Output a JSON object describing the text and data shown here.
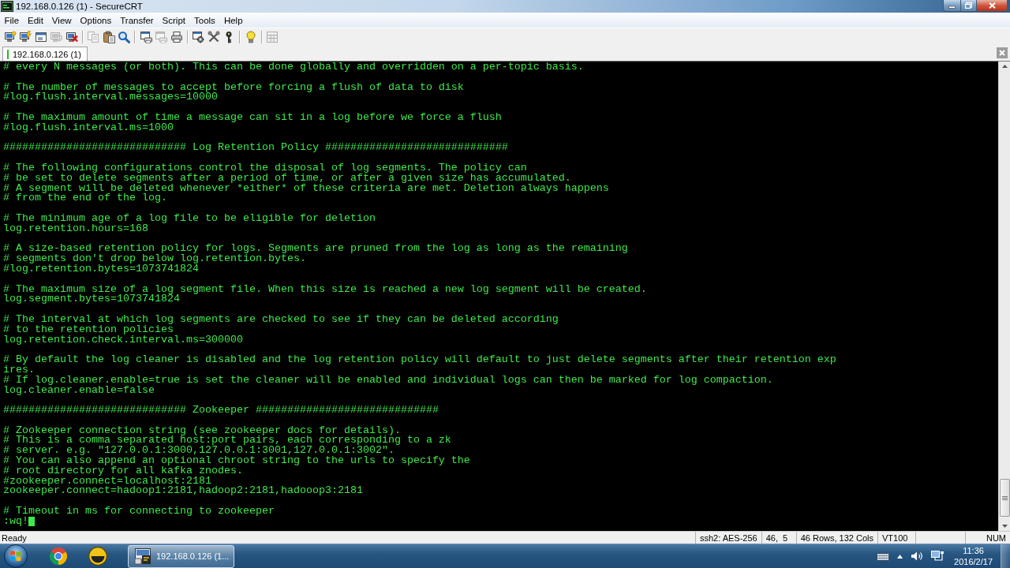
{
  "window": {
    "title": "192.168.0.126 (1) - SecureCRT"
  },
  "menu": [
    "File",
    "Edit",
    "View",
    "Options",
    "Transfer",
    "Script",
    "Tools",
    "Help"
  ],
  "toolbar": [
    {
      "kind": "connect",
      "disabled": false
    },
    {
      "kind": "quickconnect",
      "disabled": false
    },
    {
      "kind": "tab",
      "disabled": false
    },
    {
      "kind": "reconnect",
      "disabled": true
    },
    {
      "kind": "disconnect",
      "disabled": false
    },
    {
      "kind": "separator"
    },
    {
      "kind": "copy",
      "disabled": true
    },
    {
      "kind": "paste",
      "disabled": false
    },
    {
      "kind": "find",
      "disabled": false
    },
    {
      "kind": "separator"
    },
    {
      "kind": "printscreen",
      "disabled": false
    },
    {
      "kind": "printselection",
      "disabled": true
    },
    {
      "kind": "print",
      "disabled": false
    },
    {
      "kind": "separator"
    },
    {
      "kind": "sessionoptions",
      "disabled": false
    },
    {
      "kind": "globaloptions",
      "disabled": false
    },
    {
      "kind": "keymap",
      "disabled": false
    },
    {
      "kind": "separator"
    },
    {
      "kind": "help",
      "disabled": false
    },
    {
      "kind": "separator"
    },
    {
      "kind": "sftp",
      "disabled": true
    }
  ],
  "tabs": [
    {
      "label": "192.168.0.126 (1)",
      "selected": true,
      "connected": true
    }
  ],
  "terminal": {
    "blocks": [
      {
        "lines": [
          "# every N messages (or both). This can be done globally and overridden on a per-topic basis."
        ]
      },
      {
        "lines": [
          "# The number of messages to accept before forcing a flush of data to disk",
          "#log.flush.interval.messages=10000"
        ]
      },
      {
        "lines": [
          "# The maximum amount of time a message can sit in a log before we force a flush",
          "#log.flush.interval.ms=1000"
        ]
      },
      {
        "lines": [
          "############################# Log Retention Policy #############################"
        ]
      },
      {
        "lines": [
          "# The following configurations control the disposal of log segments. The policy can",
          "# be set to delete segments after a period of time, or after a given size has accumulated.",
          "# A segment will be deleted whenever *either* of these criteria are met. Deletion always happens",
          "# from the end of the log."
        ]
      },
      {
        "lines": [
          "# The minimum age of a log file to be eligible for deletion",
          "log.retention.hours=168"
        ]
      },
      {
        "lines": [
          "# A size-based retention policy for logs. Segments are pruned from the log as long as the remaining",
          "# segments don't drop below log.retention.bytes.",
          "#log.retention.bytes=1073741824"
        ]
      },
      {
        "lines": [
          "# The maximum size of a log segment file. When this size is reached a new log segment will be created.",
          "log.segment.bytes=1073741824"
        ]
      },
      {
        "lines": [
          "# The interval at which log segments are checked to see if they can be deleted according",
          "# to the retention policies",
          "log.retention.check.interval.ms=300000"
        ]
      },
      {
        "lines": [
          "# By default the log cleaner is disabled and the log retention policy will default to just delete segments after their retention exp",
          "ires.",
          "# If log.cleaner.enable=true is set the cleaner will be enabled and individual logs can then be marked for log compaction.",
          "log.cleaner.enable=false"
        ]
      },
      {
        "lines": [
          "############################# Zookeeper #############################"
        ]
      },
      {
        "lines": [
          "# Zookeeper connection string (see zookeeper docs for details).",
          "# This is a comma separated host:port pairs, each corresponding to a zk",
          "# server. e.g. \"127.0.0.1:3000,127.0.0.1:3001,127.0.0.1:3002\".",
          "# You can also append an optional chroot string to the urls to specify the",
          "# root directory for all kafka znodes.",
          "#zookeeper.connect=localhost:2181",
          "zookeeper.connect=hadoop1:2181,hadoop2:2181,hadooop3:2181"
        ]
      },
      {
        "lines": [
          "# Timeout in ms for connecting to zookeeper"
        ]
      }
    ],
    "command": {
      "text": ":wq!",
      "cursor": true
    }
  },
  "status_bar": {
    "message": "Ready",
    "panels": [
      "ssh2: AES-256",
      "46,  5",
      "46 Rows, 132 Cols",
      "VT100",
      "NUM"
    ]
  },
  "taskbar": {
    "windows": [
      {
        "label": "192.168.0.126 (1...",
        "selected": true
      }
    ],
    "clock": {
      "time": "11:36",
      "date": "2016/2/17"
    }
  }
}
